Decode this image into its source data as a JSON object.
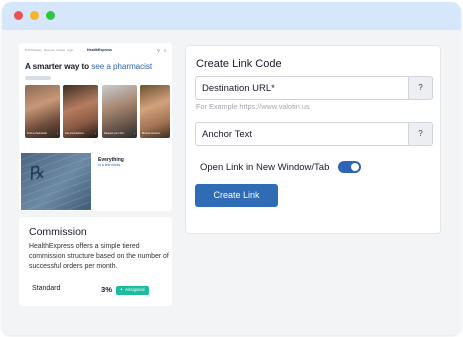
{
  "window": {
    "controls": [
      "close",
      "minimize",
      "maximize"
    ]
  },
  "preview": {
    "nav_links": "Find Pharmacy · About Us · Contact · Login",
    "brand": "HealthExpress",
    "nav_icons": [
      "search-icon",
      "menu-icon"
    ],
    "headline_main": "A smarter way to",
    "headline_highlight": "see a pharmacist",
    "photo_captions": [
      "Find a pharmacist",
      "Get prescriptions",
      "Request your first",
      "Browse services"
    ],
    "event_title": "Everything",
    "event_sub": "in a few clicks"
  },
  "commission": {
    "title": "Commission",
    "description": "HealthExpress offers a simple tiered commission structure based on the number of successful orders per month.",
    "tier_name": "Standard",
    "tier_percent": "3%",
    "tier_badge": "Assigned"
  },
  "form": {
    "title": "Create Link Code",
    "destination_label": "Destination URL*",
    "destination_help": "?",
    "destination_hint": "For Example https://www.valotin.us",
    "anchor_label": "Anchor Text",
    "anchor_help": "?",
    "new_window_label": "Open Link in New Window/Tab",
    "new_window_enabled": true,
    "submit_label": "Create Link"
  },
  "colors": {
    "accent": "#2d63b8",
    "titlebar": "#d6e6fb",
    "badge": "#1abc9c",
    "close": "#ee4f57",
    "minimize": "#f5b52d",
    "maximize": "#2fc545"
  }
}
